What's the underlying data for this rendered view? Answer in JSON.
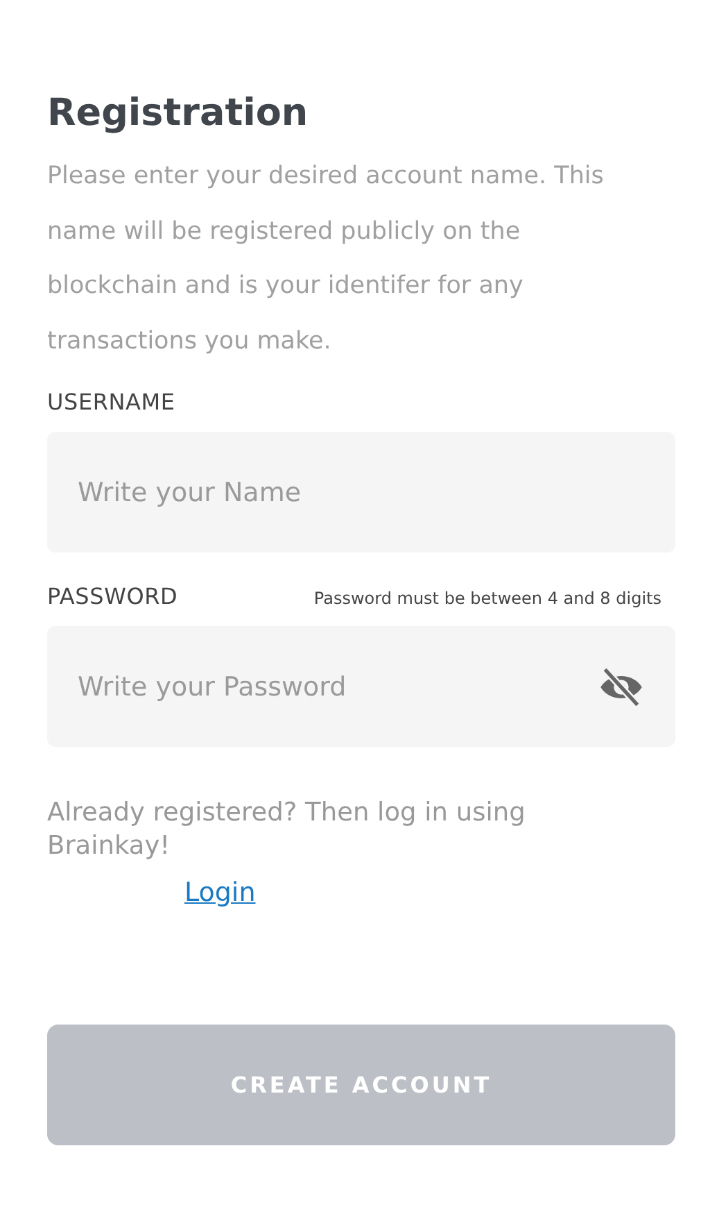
{
  "title": "Registration",
  "intro": "Please enter your desired account name. This name will be registered publicly on the blockchain and is your identifer for any transactions you make.",
  "username": {
    "label": "USERNAME",
    "placeholder": "Write your Name"
  },
  "password": {
    "label": "PASSWORD",
    "hint": "Password must be between 4 and 8 digits",
    "placeholder": "Write your Password",
    "visible": false
  },
  "login_prompt": "Already registered? Then log in using Brainkay!",
  "login_link": "Login",
  "create_button": {
    "label": "CREATE ACCOUNT",
    "disabled": true
  }
}
